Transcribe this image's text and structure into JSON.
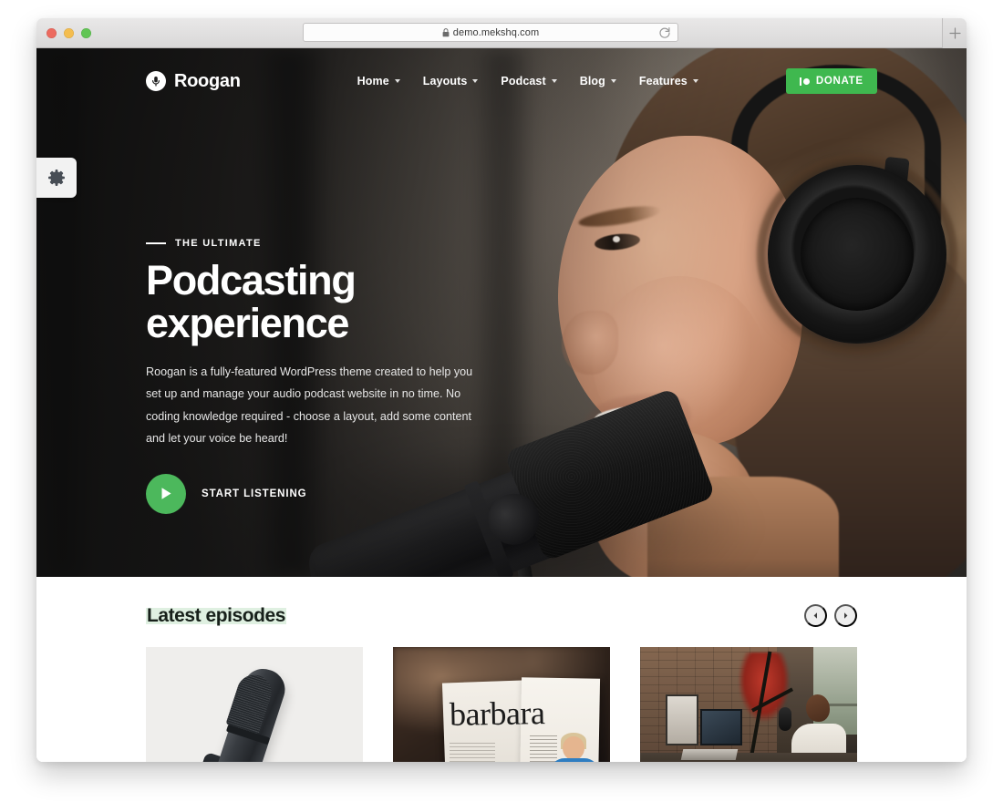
{
  "browser": {
    "url": "demo.mekshq.com",
    "lock_icon": "lock-icon",
    "reload_icon": "reload-icon",
    "newtab_icon": "plus-icon",
    "traffic_lights": [
      "close",
      "minimize",
      "zoom"
    ]
  },
  "site": {
    "brand": {
      "name": "Roogan",
      "mark_icon": "microphone-circle-logo"
    },
    "nav": [
      {
        "label": "Home",
        "has_dropdown": true
      },
      {
        "label": "Layouts",
        "has_dropdown": true
      },
      {
        "label": "Podcast",
        "has_dropdown": true
      },
      {
        "label": "Blog",
        "has_dropdown": true
      },
      {
        "label": "Features",
        "has_dropdown": true
      }
    ],
    "donate": {
      "label": "DONATE",
      "icon": "megaphone-icon",
      "color": "#3fb84f"
    },
    "settings_tab": {
      "icon": "gear-icon"
    }
  },
  "hero": {
    "eyebrow": "THE ULTIMATE",
    "title": "Podcasting experience",
    "description": "Roogan is a fully-featured WordPress theme created to help you set up and manage your audio podcast website in no time. No coding knowledge required - choose a layout, add some content and let your voice be heard!",
    "cta": {
      "label": "START LISTENING",
      "icon": "play-icon",
      "color": "#4cb85c"
    }
  },
  "episodes": {
    "title": "Latest episodes",
    "title_highlight": "#dff0e1",
    "prev_icon": "chevron-left-icon",
    "next_icon": "chevron-right-icon",
    "cards": [
      {
        "image_alt": "Condenser microphone on white background"
      },
      {
        "image_alt": "Open magazine spread with the word barbara"
      },
      {
        "image_alt": "Podcaster at desk with boom mic in brick studio"
      }
    ],
    "magazine_word": "barbara"
  }
}
